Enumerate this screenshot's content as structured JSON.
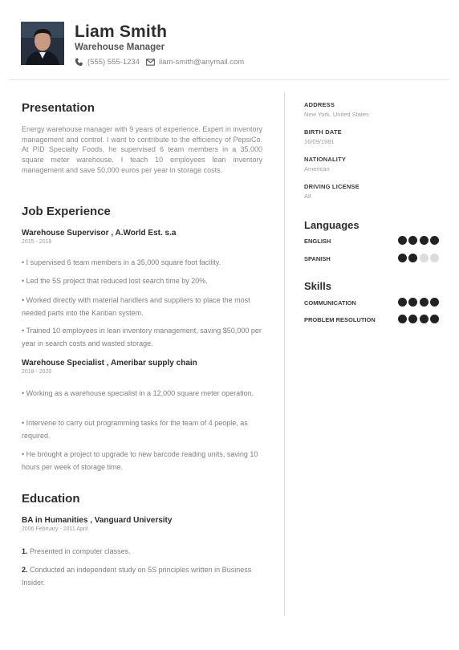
{
  "header": {
    "name": "Liam Smith",
    "title": "Warehouse Manager",
    "phone": "(555) 555-1234",
    "email": "liam-smith@anymail.com"
  },
  "presentation": {
    "heading": "Presentation",
    "text": "Energy warehouse manager with 9 years of experience. Expert in inventory management and control. I want to contribute to the efficiency of PepsiCo. At PID Specialty Foods, he supervised 6 team members in a 35,000 square meter warehouse. I teach 10 employees lean inventory management and save 50,000 euros per year in storage costs."
  },
  "experience": {
    "heading": "Job Experience",
    "jobs": [
      {
        "title": "Warehouse Supervisor , A.World Est. s.a",
        "dates": "2015 - 2018",
        "bullets": [
          "• I supervised 6 team members in a 35,000 square foot facility.",
          "• Led the 5S project that reduced lost search time by 20%.",
          "• Worked directly with material handlers and suppliers to place the most needed parts into the Kanban system.",
          "• Trained 10 employees in lean inventory management, saving $50,000 per year in search costs and wasted storage."
        ]
      },
      {
        "title": "Warehouse Specialist , Ameribar supply chain",
        "dates": "2018 - 2020",
        "bullets": [
          "• Working as a warehouse specialist in a 12,000 square meter operation.",
          "• Intervene to carry out programming tasks for the team of 4 people, as required.",
          "• He brought a project to upgrade to new barcode reading units, saving 10 hours per week of storage time."
        ]
      }
    ]
  },
  "education": {
    "heading": "Education",
    "degree": "BA in Humanities , Vanguard University",
    "dates": "2006 February - 2011 April",
    "items": [
      {
        "num": "1.",
        "text": "Presented in computer classes."
      },
      {
        "num": "2.",
        "text": "Conducted an independent study on 5S principles written in Business Insider."
      }
    ]
  },
  "info": [
    {
      "label": "ADDRESS",
      "value": "New York, United States"
    },
    {
      "label": "BIRTH DATE",
      "value": "16/09/1981"
    },
    {
      "label": "NATIONALITY",
      "value": "American"
    },
    {
      "label": "DRIVING LICENSE",
      "value": "All"
    }
  ],
  "languages": {
    "heading": "Languages",
    "items": [
      {
        "name": "ENGLISH",
        "level": 4,
        "max": 4
      },
      {
        "name": "SPANISH",
        "level": 2,
        "max": 4
      }
    ]
  },
  "skills": {
    "heading": "Skills",
    "items": [
      {
        "name": "COMMUNICATION",
        "level": 4,
        "max": 4
      },
      {
        "name": "PROBLEM RESOLUTION",
        "level": 4,
        "max": 4
      }
    ]
  },
  "icons": {
    "phone": "phone-icon",
    "email": "envelope-icon"
  },
  "colors": {
    "heading": "#2d2d2d",
    "muted": "#8a8a8a",
    "dot_on": "#222222",
    "dot_off": "#dcdcdc"
  }
}
